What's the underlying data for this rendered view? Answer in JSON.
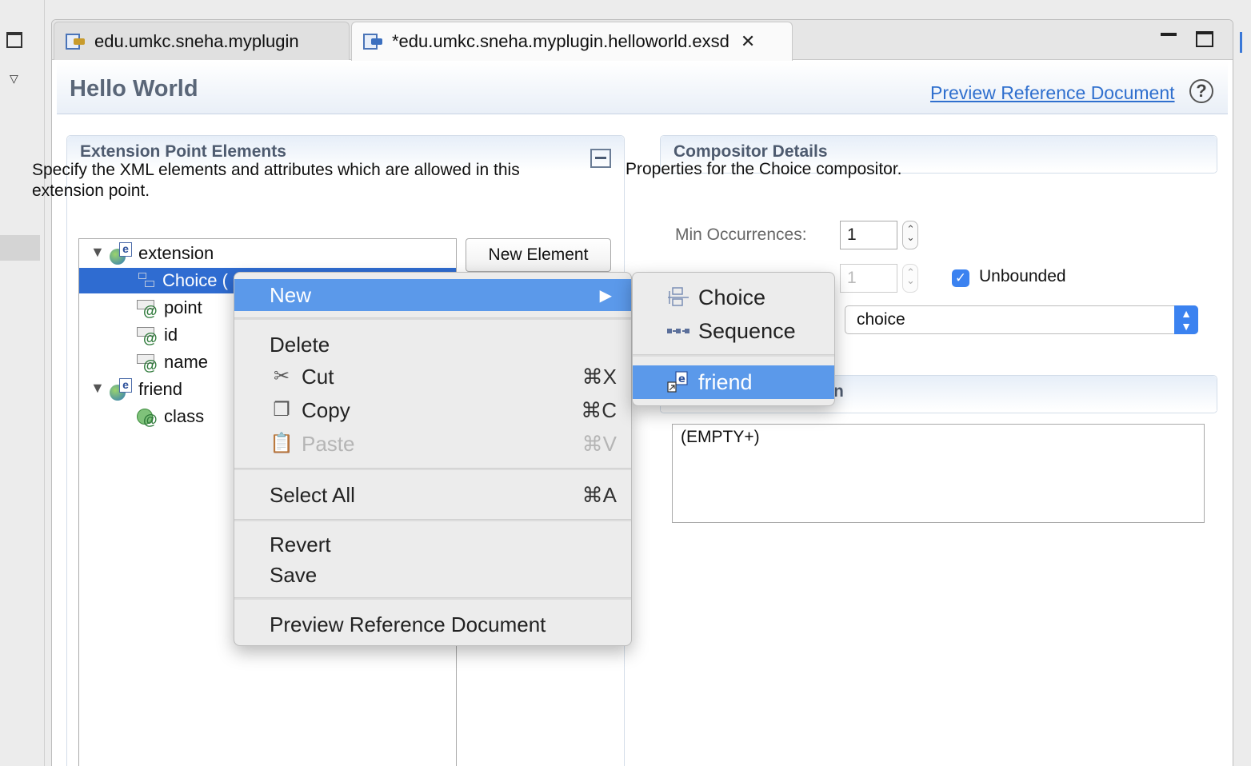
{
  "tabs": [
    {
      "label": "edu.umkc.sneha.myplugin",
      "active": false
    },
    {
      "label": "*edu.umkc.sneha.myplugin.helloworld.exsd",
      "active": true
    }
  ],
  "page": {
    "title": "Hello World",
    "preview_link": "Preview Reference Document"
  },
  "ext_section": {
    "title": "Extension Point Elements",
    "description": "Specify the XML elements and attributes which are allowed in this extension point.",
    "new_element_label": "New Element"
  },
  "tree": {
    "extension": "extension",
    "choice": "Choice (",
    "point": "point",
    "id": "id",
    "name": "name",
    "friend": "friend",
    "class": "class"
  },
  "comp_section": {
    "title": "Compositor Details",
    "description": "Properties for the Choice compositor.",
    "min_label": "Min Occurrences:",
    "min_value": "1",
    "max_value": "1",
    "unbounded_label": "Unbounded",
    "unbounded_checked": true,
    "kind_value": "choice",
    "dtd_title_fragment": "n",
    "dtd_value": "(EMPTY+)"
  },
  "context_menu": {
    "new": "New",
    "delete": "Delete",
    "cut": "Cut",
    "cut_key": "⌘X",
    "copy": "Copy",
    "copy_key": "⌘C",
    "paste": "Paste",
    "paste_key": "⌘V",
    "select_all": "Select All",
    "select_all_key": "⌘A",
    "revert": "Revert",
    "save": "Save",
    "preview": "Preview Reference Document"
  },
  "submenu": {
    "choice": "Choice",
    "sequence": "Sequence",
    "friend": "friend"
  },
  "colors": {
    "accent": "#2f6cd1",
    "menu_highlight": "#5b99ea",
    "link": "#2f6fce"
  }
}
